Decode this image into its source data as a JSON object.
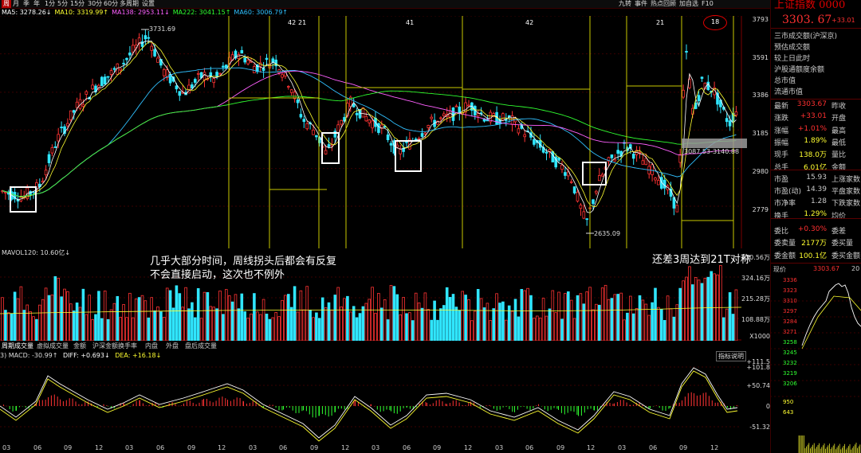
{
  "topbar": {
    "periods": [
      "周",
      "月",
      "季",
      "年",
      "1分",
      "5分",
      "15分",
      "30分",
      "60分",
      "多周期",
      "设置"
    ],
    "active_period": "周",
    "right_tools": [
      "九转",
      "事件",
      "热点回顾",
      "加自选",
      "F10"
    ]
  },
  "ma_legend": [
    {
      "label": "MA5: 3278.26↓",
      "color": "#ffffff"
    },
    {
      "label": "MA10: 3319.99↑",
      "color": "#ffff30"
    },
    {
      "label": "MA138: 2953.11↓",
      "color": "#ff60ff"
    },
    {
      "label": "MA222: 3041.15↑",
      "color": "#30ff30"
    },
    {
      "label": "MA60: 3006.79↑",
      "color": "#30c0ff"
    }
  ],
  "price_axis": [
    "3793",
    "3591",
    "3386",
    "3185",
    "2980",
    "2779"
  ],
  "chart_markers": {
    "peak_label": "3731.69",
    "low_label": "2635.09",
    "range_label": "3087.53-3140.88",
    "period_counts": [
      "42",
      "21",
      "41",
      "42",
      "21"
    ],
    "circle_count": "18"
  },
  "annotations": {
    "main_line1": "几乎大部分时间，周线拐头后都会有反复",
    "main_line2": "不会直接启动，这次也不例外",
    "right_note": "还差3周达到21T对称"
  },
  "volume": {
    "legend": "MAVOL120: 10.60亿↓",
    "axis": [
      "430.56万",
      "324.16万",
      "215.28万",
      "108.88万",
      "X1000"
    ]
  },
  "bottom_tabs": [
    "周期成交量",
    "虚拟成交量",
    "金额",
    "沪深金额",
    "换手率",
    "内盘",
    "外盘",
    "盘后成交量"
  ],
  "indicator_button": "指标说明",
  "macd": {
    "legend_name": "3) MACD: -30.99↑",
    "diff": "DIFF: +0.693↓",
    "dea": "DEA: +16.18↓",
    "axis": [
      "+111.5",
      "+101.8",
      "+50.74",
      "0",
      "-51.32"
    ]
  },
  "x_axis_labels": [
    "03",
    "06",
    "09",
    "12",
    "03",
    "06",
    "09",
    "12",
    "03",
    "06",
    "09",
    "12",
    "03",
    "06",
    "09",
    "12",
    "03",
    "06",
    "09",
    "12",
    "03",
    "06",
    "09",
    "12"
  ],
  "right_panel": {
    "title": "上证指数 0000",
    "price": "3303. 67",
    "change": "+33.01",
    "menu": [
      "三市成交额(沪深京)",
      "预估成交额",
      "较上日此时",
      "沪股通额度余额",
      "总市值",
      "流通市值"
    ],
    "quotes": [
      {
        "k": "最新",
        "v": "3303.67",
        "k2": "昨收",
        "vc": "red"
      },
      {
        "k": "涨跌",
        "v": "+33.01",
        "k2": "开盘",
        "vc": "red"
      },
      {
        "k": "涨幅",
        "v": "+1.01%",
        "k2": "最高",
        "vc": "red"
      },
      {
        "k": "振幅",
        "v": "1.89%",
        "k2": "最低",
        "vc": "yellow"
      },
      {
        "k": "现手",
        "v": "138.0万",
        "k2": "量比",
        "vc": "yellow"
      },
      {
        "k": "总手",
        "v": "6.01亿",
        "k2": "金额",
        "vc": "yellow"
      },
      {
        "k": "市盈",
        "v": "15.93",
        "k2": "上涨家数",
        "vc": "plain"
      },
      {
        "k": "市盈(动)",
        "v": "14.39",
        "k2": "平盘家数",
        "vc": "plain"
      },
      {
        "k": "市净率",
        "v": "1.28",
        "k2": "下跌家数",
        "vc": "plain"
      },
      {
        "k": "换手",
        "v": "1.29%",
        "k2": "均价",
        "vc": "yellow"
      },
      {
        "k": "委比",
        "v": "+0.30%",
        "k2": "委差",
        "vc": "red"
      },
      {
        "k": "委卖量",
        "v": "2177万",
        "k2": "委买量",
        "vc": "yellow"
      },
      {
        "k": "委金额",
        "v": "100.1亿",
        "k2": "委买金额",
        "vc": "yellow"
      }
    ],
    "intraday": {
      "label": "现价",
      "price": "3303.67",
      "extra": "20",
      "ticks": [
        "3336",
        "3323",
        "3310",
        "3297",
        "3284",
        "3271",
        "3258",
        "3245",
        "3232",
        "3219",
        "3206",
        "950",
        "643"
      ]
    }
  }
}
